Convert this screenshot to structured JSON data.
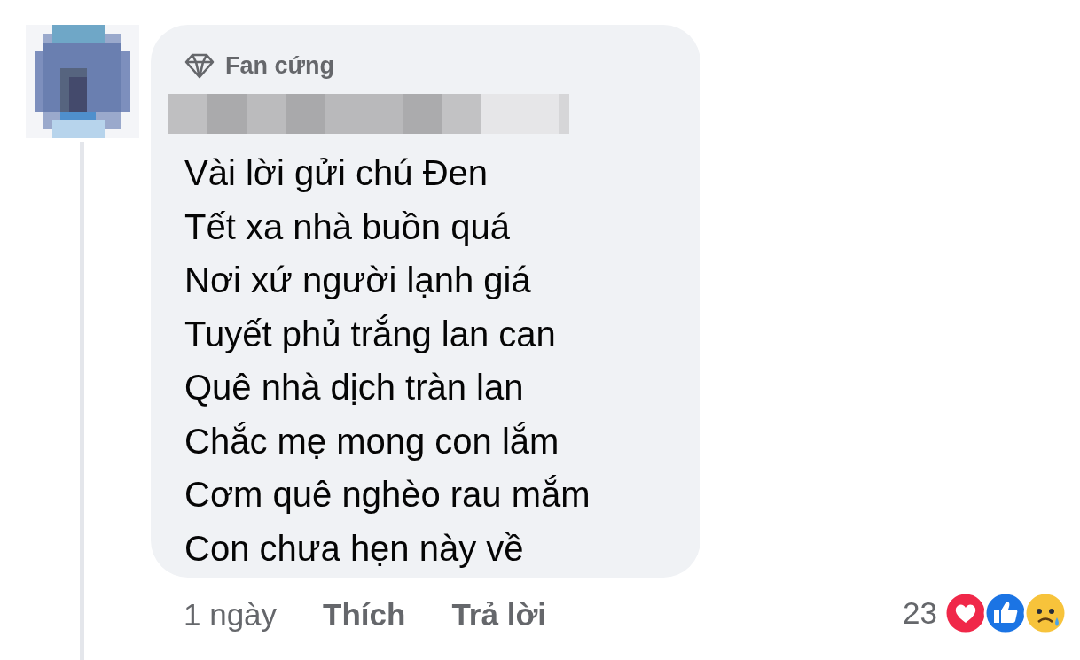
{
  "comment": {
    "badge": "Fan cứng",
    "lines": [
      "Vài lời gửi chú Đen",
      "Tết xa nhà buồn quá",
      "Nơi xứ người lạnh giá",
      "Tuyết phủ trắng lan can",
      "Quê nhà dịch tràn lan",
      "Chắc mẹ mong con lắm",
      "Cơm quê nghèo rau mắm",
      "Con chưa hẹn này về"
    ],
    "time": "1 ngày",
    "actions": [
      "Thích",
      "Trả lời"
    ],
    "reaction_count": "23",
    "reactions": [
      {
        "kind": "love"
      },
      {
        "kind": "like"
      },
      {
        "kind": "sad"
      }
    ]
  }
}
